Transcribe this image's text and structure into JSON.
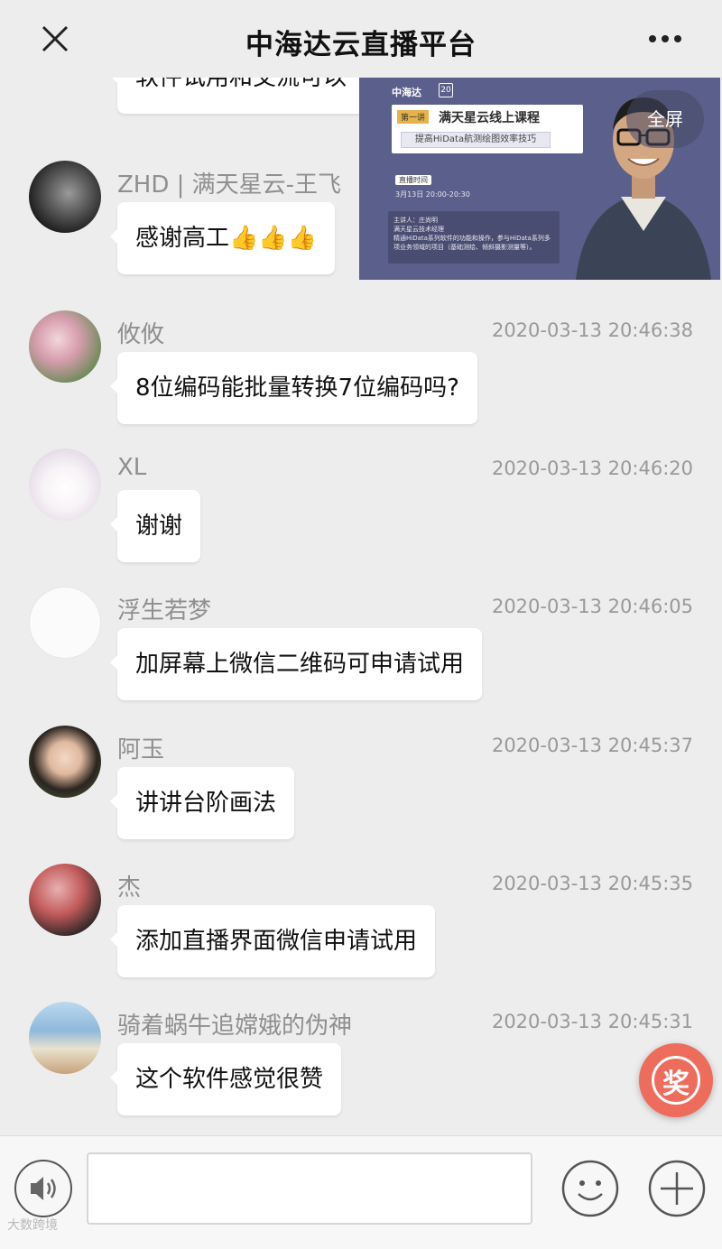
{
  "header": {
    "title": "中海达云直播平台"
  },
  "video": {
    "logo": "中海达",
    "logo_badge": "20",
    "lecture_tag": "第一讲",
    "course_title": "满天星云线上课程",
    "course_subtitle": "提高HiData航测绘图效率技巧",
    "live_badge": "直播时间",
    "live_time": "3月13日 20:00-20:30",
    "speaker": "主讲人：庄尚明",
    "speaker_role": "满天星云技术经理",
    "intro": "精通HiData系列软件的功能和操作，参与HiData系列多项业务领域的项目（基础测绘、倾斜摄影测量等）。",
    "fullscreen_label": "全屏"
  },
  "messages": [
    {
      "name": "",
      "time": "",
      "text": "软件试用和交流可以"
    },
    {
      "name": "ZHD | 满天星云-王飞",
      "time": "",
      "text": "感谢高工👍👍👍"
    },
    {
      "name": "攸攸",
      "time": "2020-03-13 20:46:38",
      "text": "8位编码能批量转换7位编码吗?"
    },
    {
      "name": "XL",
      "time": "2020-03-13 20:46:20",
      "text": "谢谢"
    },
    {
      "name": "浮生若梦",
      "time": "2020-03-13 20:46:05",
      "text": "加屏幕上微信二维码可申请试用"
    },
    {
      "name": "阿玉",
      "time": "2020-03-13 20:45:37",
      "text": "讲讲台阶画法"
    },
    {
      "name": "杰",
      "time": "2020-03-13 20:45:35",
      "text": "添加直播界面微信申请试用"
    },
    {
      "name": "骑着蜗牛追嫦娥的伪神",
      "time": "2020-03-13 20:45:31",
      "text": "这个软件感觉很赞"
    }
  ],
  "reward": {
    "label": "奖"
  },
  "input": {
    "value": "",
    "placeholder": ""
  },
  "icons": {
    "close": "close-icon",
    "more": "more-icon",
    "voice": "speaker-icon",
    "emoji": "smile-icon",
    "plus": "plus-icon"
  },
  "colors": {
    "reward": "#ee6c5c",
    "background": "#ededed",
    "video_bg": "#5b5f8c"
  },
  "watermark": "大数跨境"
}
